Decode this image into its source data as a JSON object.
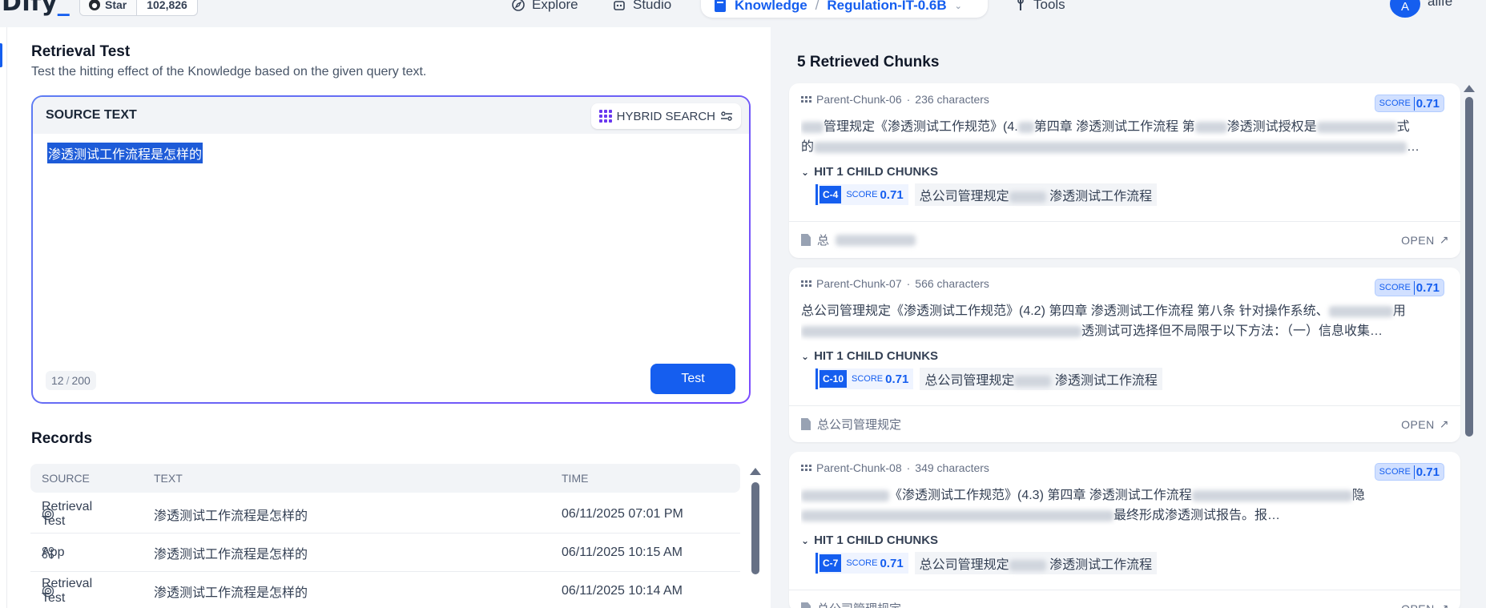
{
  "topbar": {
    "logo": "Dify",
    "github_star": "Star",
    "github_count": "102,826",
    "nav_explore": "Explore",
    "nav_studio": "Studio",
    "nav_knowledge": "Knowledge",
    "dataset_name": "Regulation-IT-0.6B",
    "nav_tools": "Tools",
    "avatar_initial": "A",
    "username": "alife"
  },
  "retrieval": {
    "title": "Retrieval Test",
    "description": "Test the hitting effect of the Knowledge based on the given query text.",
    "source_label": "SOURCE TEXT",
    "search_mode": "HYBRID SEARCH",
    "query": "渗透测试工作流程是怎样的",
    "counter_current": "12",
    "counter_max": "200",
    "test_button": "Test"
  },
  "records": {
    "title": "Records",
    "columns": [
      "SOURCE",
      "TEXT",
      "TIME"
    ],
    "rows": [
      {
        "source": "Retrieval Test",
        "icon": "target-icon",
        "text": "渗透测试工作流程是怎样的",
        "time": "06/11/2025 07:01 PM"
      },
      {
        "source": "App",
        "icon": "app-grid-icon",
        "text": "渗透测试工作流程是怎样的",
        "time": "06/11/2025 10:15 AM"
      },
      {
        "source": "Retrieval Test",
        "icon": "target-icon",
        "text": "渗透测试工作流程是怎样的",
        "time": "06/11/2025 10:14 AM"
      }
    ]
  },
  "chunks": {
    "title": "5 Retrieved Chunks",
    "hit_label": "HIT 1 CHILD CHUNKS",
    "open_label": "OPEN",
    "score_label": "SCORE",
    "items": [
      {
        "name": "Parent-Chunk-06",
        "chars": "236 characters",
        "score": "0.71",
        "line1": "管理规定《渗透测试工作规范》(4.",
        "line1b": "第四章 渗透测试工作流程 第",
        "line1c": "渗透测试授权是",
        "line1d": "式",
        "line2": "的",
        "line2b": "…",
        "child_id": "C-4",
        "child_score": "0.71",
        "child_text_a": "总公司管理规定",
        "child_text_b": "渗透测试工作流程",
        "doc": "总"
      },
      {
        "name": "Parent-Chunk-07",
        "chars": "566 characters",
        "score": "0.71",
        "line1": "总公司管理规定《渗透测试工作规范》(4.2) 第四章 渗透测试工作流程 第八条 针对操作系统、",
        "line1b": "用",
        "line2": "透测试可选择但不局限于以下方法：（一）信息收集…",
        "child_id": "C-10",
        "child_score": "0.71",
        "child_text_a": "总公司管理规定",
        "child_text_b": "渗透测试工作流程",
        "doc": "总公司管理规定"
      },
      {
        "name": "Parent-Chunk-08",
        "chars": "349 characters",
        "score": "0.71",
        "line1": "《渗透测试工作规范》(4.3) 第四章 渗透测试工作流程",
        "line1b": "隐",
        "line2": "最终形成渗透测试报告。报",
        "line2b": "…",
        "child_id": "C-7",
        "child_score": "0.71",
        "child_text_a": "总公司管理规定",
        "child_text_b": "渗透测试工作流程",
        "doc": "总公司管理规定"
      }
    ]
  },
  "colors": {
    "accent": "#155eef",
    "gradient_purple": "#7c4dff"
  }
}
